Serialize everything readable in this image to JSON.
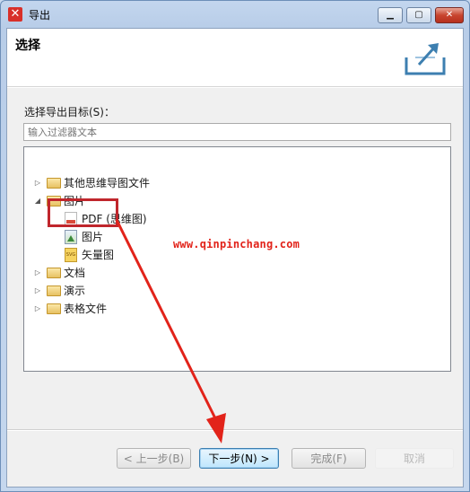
{
  "window": {
    "title": "导出",
    "app_icon": "xmind-x-icon"
  },
  "header": {
    "title": "选择",
    "icon": "export-icon"
  },
  "target_label": "选择导出目标(S)：",
  "filter": {
    "placeholder": "输入过滤器文本",
    "value": ""
  },
  "tree": {
    "items": [
      {
        "label": "其他思维导图文件",
        "type": "folder",
        "expanded": false
      },
      {
        "label": "图片",
        "type": "folder",
        "expanded": true
      },
      {
        "label": "PDF (思维图)",
        "type": "file",
        "icon": "pdf-icon"
      },
      {
        "label": "图片",
        "type": "file",
        "icon": "image-icon",
        "selected": true
      },
      {
        "label": "矢量图",
        "type": "file",
        "icon": "svg-icon",
        "icon_text": "SVG"
      },
      {
        "label": "文档",
        "type": "folder",
        "expanded": false
      },
      {
        "label": "演示",
        "type": "folder",
        "expanded": false
      },
      {
        "label": "表格文件",
        "type": "folder",
        "expanded": false
      }
    ]
  },
  "watermark": "www.qinpinchang.com",
  "buttons": {
    "back": "< 上一步(B)",
    "next": "下一步(N) >",
    "finish": "完成(F)",
    "cancel": "取消"
  },
  "colors": {
    "highlight": "#c0262c",
    "annotation_arrow": "#e2231a"
  }
}
